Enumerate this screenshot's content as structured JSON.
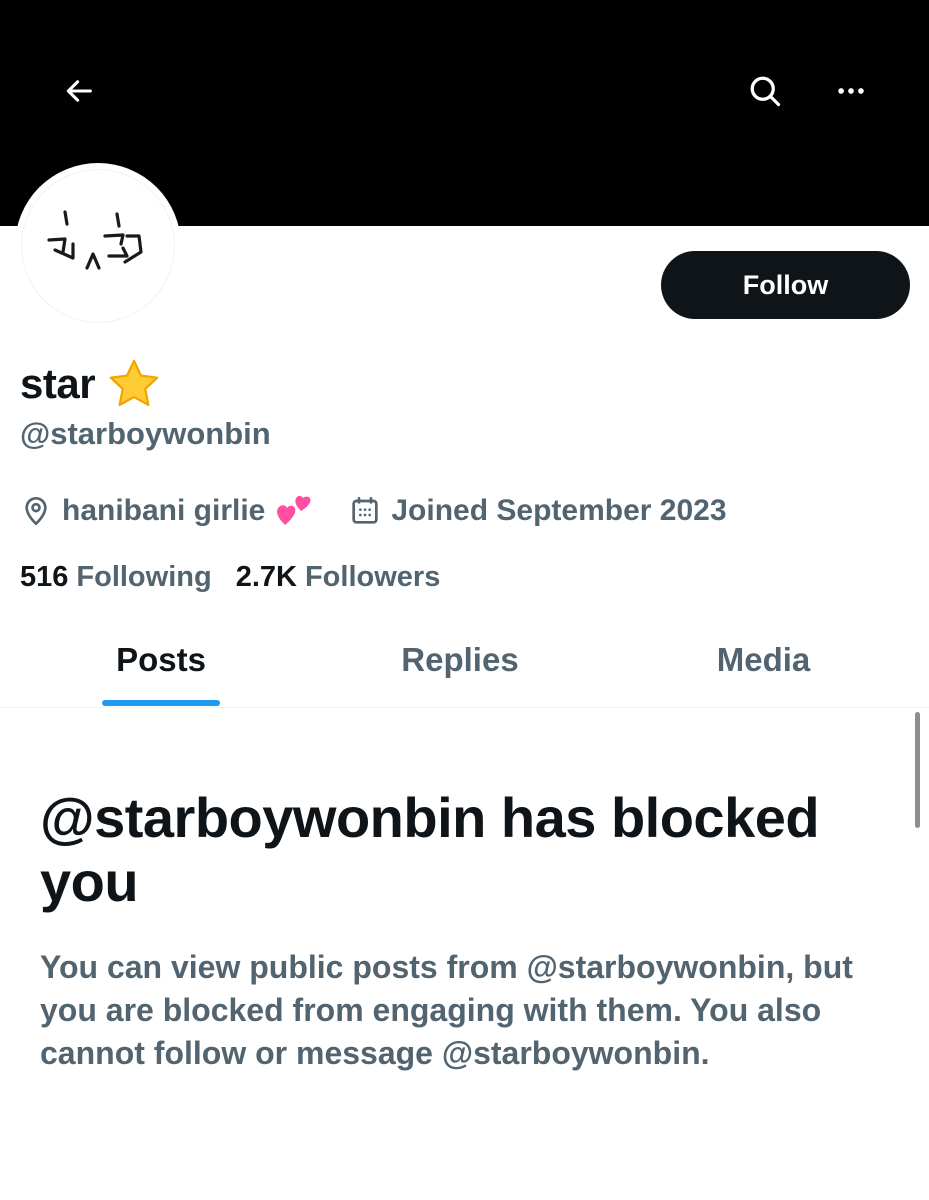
{
  "header": {
    "back_icon": "arrow-left-icon",
    "search_icon": "search-icon",
    "more_icon": "more-horizontal-icon"
  },
  "profile": {
    "display_name": "star",
    "name_emoji": "⭐",
    "handle": "@starboywonbin",
    "location": "hanibani girlie",
    "location_emoji": "💕",
    "joined": "Joined September 2023",
    "follow_label": "Follow",
    "following_count": "516",
    "following_label": "Following",
    "followers_count": "2.7K",
    "followers_label": "Followers"
  },
  "tabs": [
    {
      "label": "Posts",
      "active": true
    },
    {
      "label": "Replies",
      "active": false
    },
    {
      "label": "Media",
      "active": false
    }
  ],
  "blocked": {
    "title": "@starboywonbin has blocked you",
    "description": "You can view public posts from @starboywonbin, but you are blocked from engaging with them. You also cannot follow or message @starboywonbin."
  },
  "colors": {
    "accent": "#1d9bf0",
    "text_primary": "#0f1419",
    "text_secondary": "#536471",
    "banner": "#000000"
  }
}
